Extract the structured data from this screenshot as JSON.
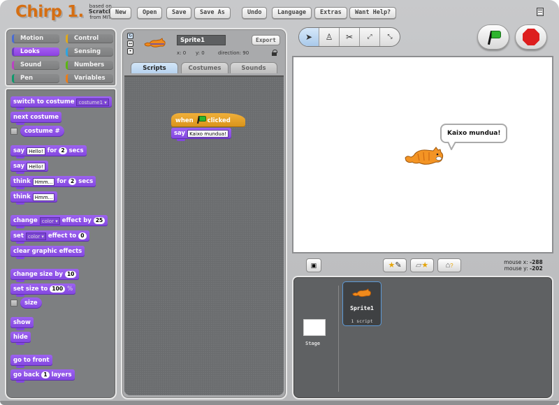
{
  "app": {
    "logo": "Chirp 1.",
    "logo_sub": [
      "based on",
      "Scratch",
      "from MIT"
    ]
  },
  "menu": {
    "new": "New",
    "open": "Open",
    "save": "Save",
    "save_as": "Save As",
    "undo": "Undo",
    "language": "Language",
    "extras": "Extras",
    "help": "Want Help?"
  },
  "categories": [
    {
      "label": "Motion",
      "color": "#4a6cd4"
    },
    {
      "label": "Control",
      "color": "#e1a91a"
    },
    {
      "label": "Looks",
      "color": "#8a55d7",
      "active": true
    },
    {
      "label": "Sensing",
      "color": "#2ca5e2"
    },
    {
      "label": "Sound",
      "color": "#bb42c3"
    },
    {
      "label": "Numbers",
      "color": "#5cb712"
    },
    {
      "label": "Pen",
      "color": "#0e9a6c"
    },
    {
      "label": "Variables",
      "color": "#ee7d16"
    }
  ],
  "blocks": {
    "switch_costume": "switch to costume",
    "costume_opt": "costume1",
    "next_costume": "next costume",
    "costume_num": "costume #",
    "say": "say",
    "hello": "Hello!",
    "for": "for",
    "secs": "secs",
    "two": "2",
    "think": "think",
    "hmm": "Hmm...",
    "change": "change",
    "color_opt": "color",
    "effect_by": "effect by",
    "twentyfive": "25",
    "set": "set",
    "effect_to": "effect to",
    "zero": "0",
    "clear_effects": "clear graphic effects",
    "change_size": "change size by",
    "ten": "10",
    "set_size": "set size to",
    "hundred": "100",
    "percent": "%",
    "size": "size",
    "show": "show",
    "hide": "hide",
    "go_front": "go to front",
    "go_back": "go back",
    "one": "1",
    "layers": "layers"
  },
  "sprite": {
    "name": "Sprite1",
    "export": "Export",
    "x": "x: 0",
    "y": "y: 0",
    "direction": "direction: 90"
  },
  "tabs": [
    "Scripts",
    "Costumes",
    "Sounds"
  ],
  "script": {
    "when": "when",
    "clicked": "clicked",
    "say": "say",
    "message": "Kaixo mundua!"
  },
  "stage": {
    "bubble": "Kaixo mundua!",
    "mouse_x_label": "mouse x:",
    "mouse_x": "-288",
    "mouse_y_label": "mouse y:",
    "mouse_y": "-202"
  },
  "sprite_list": {
    "stage_label": "Stage",
    "sprite_name": "Sprite1",
    "sprite_scripts": "1 script"
  }
}
